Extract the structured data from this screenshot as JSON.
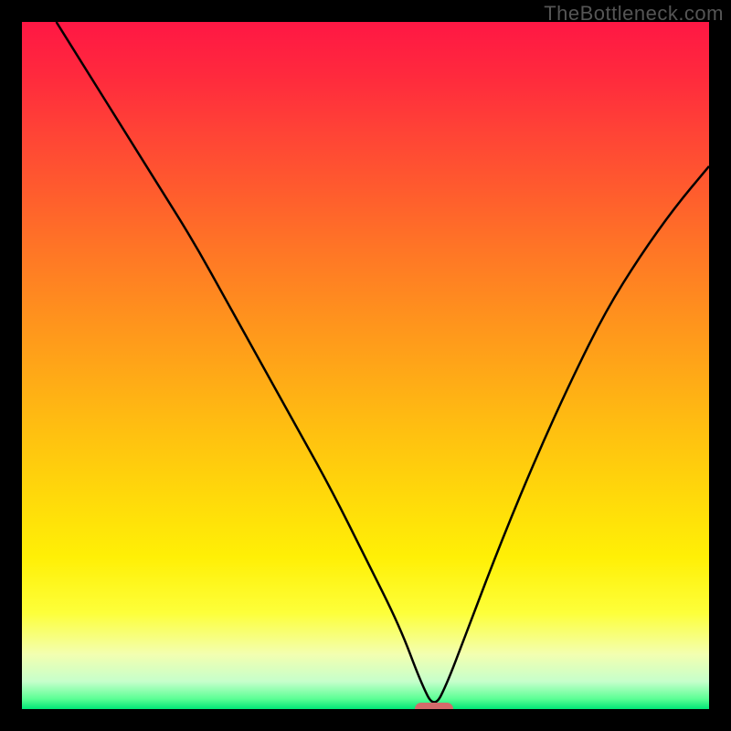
{
  "watermark": "TheBottleneck.com",
  "chart_data": {
    "type": "line",
    "title": "",
    "xlabel": "",
    "ylabel": "",
    "xlim": [
      0,
      100
    ],
    "ylim": [
      0,
      100
    ],
    "grid": false,
    "legend": false,
    "background": "rainbow-green-to-red-vertical",
    "x": [
      5,
      10,
      15,
      20,
      25,
      30,
      35,
      40,
      45,
      50,
      55,
      58,
      60,
      62,
      65,
      70,
      75,
      80,
      85,
      90,
      95,
      100
    ],
    "values": [
      100,
      92,
      84,
      76,
      68,
      59,
      50,
      41,
      32,
      22,
      12,
      4,
      0,
      4,
      12,
      25,
      37,
      48,
      58,
      66,
      73,
      79
    ],
    "optimum_x": 60,
    "optimum_value": 0,
    "marker": {
      "x": 60,
      "y": 0,
      "color": "#d46a6a"
    }
  }
}
